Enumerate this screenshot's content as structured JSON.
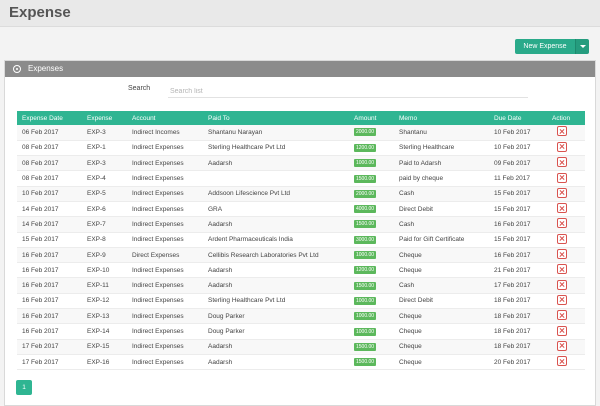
{
  "page": {
    "title": "Expense"
  },
  "toolbar": {
    "new_label": "New Expense"
  },
  "panel": {
    "title": "Expenses"
  },
  "search": {
    "label": "Search",
    "placeholder": "Search list"
  },
  "table": {
    "columns": [
      "Expense Date",
      "Expense",
      "Account",
      "Paid To",
      "Amount",
      "Memo",
      "Due Date",
      "Action"
    ],
    "rows": [
      [
        "06 Feb 2017",
        "EXP-3",
        "Indirect Incomes",
        "Shantanu Narayan",
        "2000.00",
        "Shantanu",
        "10 Feb 2017"
      ],
      [
        "08 Feb 2017",
        "EXP-1",
        "Indirect Expenses",
        "Sterling Healthcare Pvt Ltd",
        "1200.00",
        "Sterling Healthcare",
        "10 Feb 2017"
      ],
      [
        "08 Feb 2017",
        "EXP-3",
        "Indirect Expenses",
        "Aadarsh",
        "1000.00",
        "Paid to Adarsh",
        "09 Feb 2017"
      ],
      [
        "08 Feb 2017",
        "EXP-4",
        "Indirect Expenses",
        "",
        "1500.00",
        "paid by cheque",
        "11 Feb 2017"
      ],
      [
        "10 Feb 2017",
        "EXP-5",
        "Indirect Expenses",
        "Addsoon Lifescience Pvt Ltd",
        "2000.00",
        "Cash",
        "15 Feb 2017"
      ],
      [
        "14 Feb 2017",
        "EXP-6",
        "Indirect Expenses",
        "GRA",
        "4000.00",
        "Direct Debit",
        "15 Feb 2017"
      ],
      [
        "14 Feb 2017",
        "EXP-7",
        "Indirect Expenses",
        "Aadarsh",
        "1500.00",
        "Cash",
        "16 Feb 2017"
      ],
      [
        "15 Feb 2017",
        "EXP-8",
        "Indirect Expenses",
        "Ardent Pharmaceuticals India",
        "3000.00",
        "Paid for Gift Certificate",
        "15 Feb 2017"
      ],
      [
        "16 Feb 2017",
        "EXP-9",
        "Direct Expenses",
        "Cellibis Research Laboratories Pvt Ltd",
        "1000.00",
        "Cheque",
        "16 Feb 2017"
      ],
      [
        "16 Feb 2017",
        "EXP-10",
        "Indirect Expenses",
        "Aadarsh",
        "1200.00",
        "Cheque",
        "21 Feb 2017"
      ],
      [
        "16 Feb 2017",
        "EXP-11",
        "Indirect Expenses",
        "Aadarsh",
        "1500.00",
        "Cash",
        "17 Feb 2017"
      ],
      [
        "16 Feb 2017",
        "EXP-12",
        "Indirect Expenses",
        "Sterling Healthcare Pvt Ltd",
        "1000.00",
        "Direct Debit",
        "18 Feb 2017"
      ],
      [
        "16 Feb 2017",
        "EXP-13",
        "Indirect Expenses",
        "Doug Parker",
        "1000.00",
        "Cheque",
        "18 Feb 2017"
      ],
      [
        "16 Feb 2017",
        "EXP-14",
        "Indirect Expenses",
        "Doug Parker",
        "1000.00",
        "Cheque",
        "18 Feb 2017"
      ],
      [
        "17 Feb 2017",
        "EXP-15",
        "Indirect Expenses",
        "Aadarsh",
        "1500.00",
        "Cheque",
        "18 Feb 2017"
      ],
      [
        "17 Feb 2017",
        "EXP-16",
        "Indirect Expenses",
        "Aadarsh",
        "1500.00",
        "Cheque",
        "20 Feb 2017"
      ]
    ]
  },
  "pagination": {
    "current": "1"
  },
  "colors": {
    "accent": "#2fb592",
    "amount_badge": "#5cb85c",
    "delete": "#d9534f",
    "panel_header": "#8b8b8b"
  }
}
